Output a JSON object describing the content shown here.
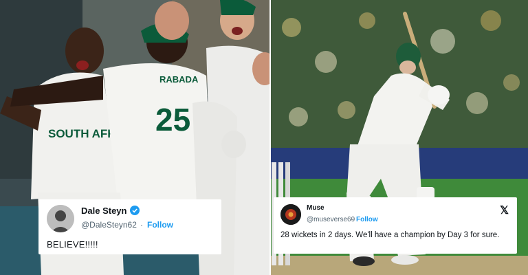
{
  "left_photo": {
    "jersey_number": "25",
    "jersey_name": "RABADA",
    "chest_text": "SOUTH AFRICA"
  },
  "tweets": [
    {
      "name": "Dale Steyn",
      "handle": "@DaleSteyn62",
      "separator": "·",
      "follow_label": "Follow",
      "text": "BELIEVE!!!!!",
      "verified_icon": "verified-badge-icon",
      "avatar_icon": "profile-photo-icon"
    },
    {
      "name": "Muse",
      "handle": "@museverse69",
      "separator": "·",
      "follow_label": "Follow",
      "text": "28 wickets in 2 days. We'll have a champion by Day 3 for sure.",
      "platform_logo": "𝕏",
      "avatar_icon": "profile-photo-icon"
    }
  ],
  "colors": {
    "sa_green": "#0b5b3a",
    "field_green": "#3f8a3a",
    "follow_blue": "#1d9bf0"
  }
}
